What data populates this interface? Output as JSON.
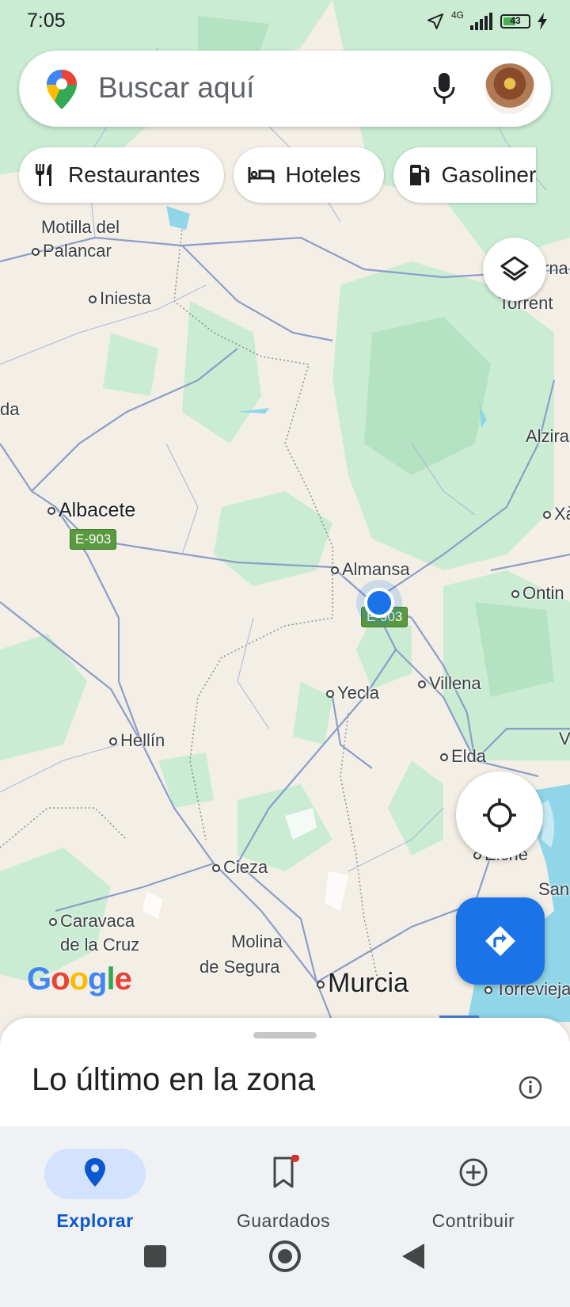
{
  "status_bar": {
    "time": "7:05",
    "network": "4G",
    "battery_level": "43"
  },
  "search": {
    "placeholder": "Buscar aquí"
  },
  "chips": [
    {
      "label": "Restaurantes",
      "icon": "fork-knife-icon"
    },
    {
      "label": "Hoteles",
      "icon": "bed-icon"
    },
    {
      "label": "Gasoliner",
      "icon": "gas-station-icon"
    }
  ],
  "map": {
    "places": {
      "motilla": "Motilla del",
      "palancar": "Palancar",
      "iniesta": "Iniesta",
      "torrent": "Torrent",
      "alzira": "Alzira",
      "da": "da",
      "albacete": "Albacete",
      "xa": "Xà",
      "almansa": "Almansa",
      "ontin": "Ontin",
      "villena": "Villena",
      "yecla": "Yecla",
      "hellin": "Hellín",
      "elda": "Elda",
      "v": "V",
      "elche": "Elche",
      "cieza": "Cieza",
      "san": "San",
      "caravaca1": "Caravaca",
      "caravaca2": "de la Cruz",
      "molina1": "Molina",
      "molina2": "de Segura",
      "murcia": "Murcia",
      "torrevieja": "Torrevieja",
      "rna": "rna"
    },
    "road_shields": {
      "albacete": "E-903",
      "almansa": "E-903"
    },
    "attribution": "Google"
  },
  "sheet": {
    "title": "Lo último en la zona"
  },
  "bottom_nav": [
    {
      "label": "Explorar",
      "icon": "explore-pin-icon",
      "active": true
    },
    {
      "label": "Guardados",
      "icon": "bookmark-icon",
      "active": false
    },
    {
      "label": "Contribuir",
      "icon": "add-circle-icon",
      "active": false
    }
  ],
  "colors": {
    "accent": "#1a73e8",
    "active_pill": "#d3e3fd",
    "active_label": "#0b57d0",
    "map_land": "#f3efe6",
    "map_green": "#c9ecd2",
    "water": "#90d6e8",
    "notification_dot": "#d93025"
  }
}
